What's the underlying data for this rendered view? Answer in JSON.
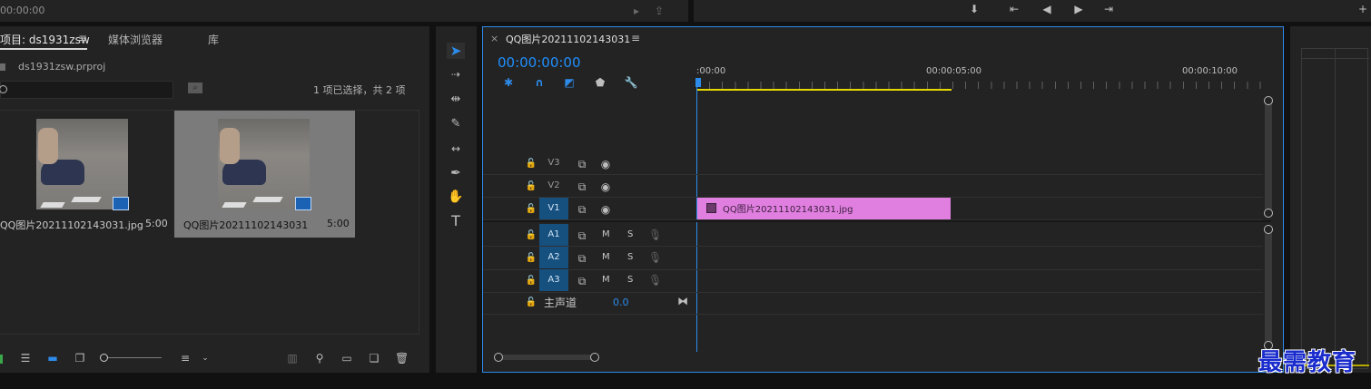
{
  "colors": {
    "accent_blue": "#2d8ceb",
    "timecode_blue": "#1f8fff",
    "clip_pink": "#e07fe0",
    "work_area_yellow": "#e6d900",
    "selected_track": "#16507f",
    "watermark": "#1a2ccc"
  },
  "top_bar": {
    "source_timecode": "00:00:00"
  },
  "project_panel": {
    "tabs": [
      {
        "label": "项目: ds1931zsw",
        "active": true
      },
      {
        "label": "媒体浏览器",
        "active": false
      },
      {
        "label": "库",
        "active": false
      }
    ],
    "menu_icon": "hamburger-icon",
    "project_file": "ds1931zsw.prproj",
    "search": {
      "value": "",
      "placeholder": ""
    },
    "selection_status": "1 项已选择，共 2 项",
    "items": [
      {
        "name": "QQ图片20211102143031.jpg",
        "duration": "5:00",
        "selected": false
      },
      {
        "name": "QQ图片20211102143031",
        "duration": "5:00",
        "selected": true
      }
    ],
    "footer_icons": [
      "list-view-icon",
      "icon-view-icon",
      "freeform-view-icon",
      "zoom-slider",
      "sort-icon",
      "automate-icon",
      "find-icon",
      "new-bin-icon",
      "new-item-icon",
      "trash-icon"
    ]
  },
  "tools": [
    "selection-tool-icon",
    "track-select-tool-icon",
    "ripple-edit-tool-icon",
    "razor-tool-icon",
    "slip-tool-icon",
    "pen-tool-icon",
    "hand-tool-icon",
    "type-tool-icon"
  ],
  "timeline": {
    "close_label": "×",
    "sequence_name": "QQ图片20211102143031",
    "timecode": "00:00:00:00",
    "ruler": [
      ":00:00",
      "00:00:05:00",
      "00:00:10:00"
    ],
    "work_area_fraction": 0.5,
    "video_tracks": [
      {
        "label": "V3",
        "source_patch": "",
        "selected": false
      },
      {
        "label": "V2",
        "source_patch": "",
        "selected": false
      },
      {
        "label": "V1",
        "source_patch": "V1",
        "selected": true
      }
    ],
    "audio_tracks": [
      {
        "label": "A1",
        "source_patch": "A1",
        "m": "M",
        "s": "S"
      },
      {
        "label": "A2",
        "source_patch": "A2",
        "m": "M",
        "s": "S"
      },
      {
        "label": "A3",
        "source_patch": "A3",
        "m": "M",
        "s": "S"
      }
    ],
    "master": {
      "label": "主声道",
      "value": "0.0"
    },
    "clip": {
      "name": "QQ图片20211102143031.jpg",
      "track": "V1"
    }
  },
  "watermark": "最需教育"
}
